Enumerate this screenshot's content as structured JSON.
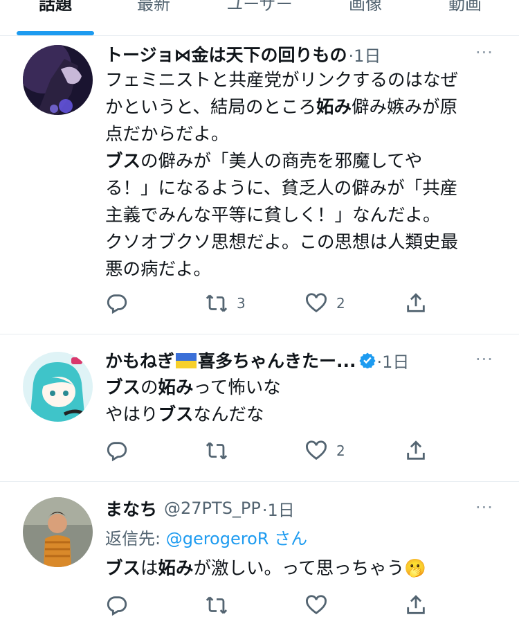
{
  "tabs": [
    {
      "label": "話題",
      "active": true
    },
    {
      "label": "最新"
    },
    {
      "label": "ユーザー"
    },
    {
      "label": "画像"
    },
    {
      "label": "動画"
    }
  ],
  "tweets": [
    {
      "name": "トージョ⋈金は天下の回りもの",
      "time": "·1日",
      "more": "···",
      "lines": [
        {
          "parts": [
            {
              "t": "フェミニストと共産党がリンクするのはなぜ"
            }
          ]
        },
        {
          "parts": [
            {
              "t": "かというと、結局のところ"
            },
            {
              "t": "妬み",
              "b": true
            },
            {
              "t": "僻み嫉みが原"
            }
          ]
        },
        {
          "parts": [
            {
              "t": "点だからだよ。"
            }
          ]
        },
        {
          "parts": [
            {
              "t": "ブス",
              "b": true
            },
            {
              "t": "の僻みが「美人の商売を邪魔してや"
            }
          ]
        },
        {
          "parts": [
            {
              "t": "る！」になるように、貧乏人の僻みが「共産"
            }
          ]
        },
        {
          "parts": [
            {
              "t": "主義でみんな平等に貧しく！」なんだよ。"
            }
          ]
        },
        {
          "parts": [
            {
              "t": "クソオブクソ思想だよ。この思想は人類史最"
            }
          ]
        },
        {
          "parts": [
            {
              "t": "悪の病だよ。"
            }
          ]
        }
      ],
      "retweets": "3",
      "likes": "2"
    },
    {
      "name_before_flag": "かもねぎ",
      "name_after_flag": "喜多ちゃんきたー...",
      "time": "·1日",
      "more": "···",
      "lines": [
        {
          "parts": [
            {
              "t": "ブス",
              "b": true
            },
            {
              "t": "の"
            },
            {
              "t": "妬み",
              "b": true
            },
            {
              "t": "って怖いな"
            }
          ]
        },
        {
          "parts": [
            {
              "t": "やはり"
            },
            {
              "t": "ブス",
              "b": true
            },
            {
              "t": "なんだな"
            }
          ]
        }
      ],
      "retweets": "",
      "likes": "2"
    },
    {
      "name": "まなち",
      "handle": "@27PTS_PP",
      "time": "·1日",
      "more": "···",
      "reply_prefix": "返信先: ",
      "reply_mention": "@gerogeroR",
      "reply_suffix": "さん",
      "lines": [
        {
          "parts": [
            {
              "t": "ブス",
              "b": true
            },
            {
              "t": "は"
            },
            {
              "t": "妬み",
              "b": true
            },
            {
              "t": "が激しい。って思っちゃう"
            },
            {
              "t": "🫢"
            }
          ]
        }
      ],
      "retweets": "",
      "likes": ""
    }
  ],
  "colors": {
    "accent": "#1d9bf0",
    "text": "#0f1419",
    "muted": "#536471",
    "border": "#e6ecf0"
  },
  "icons": [
    "reply-icon",
    "retweet-icon",
    "like-icon",
    "share-icon",
    "more-icon",
    "verified-icon",
    "ukraine-flag-icon"
  ]
}
